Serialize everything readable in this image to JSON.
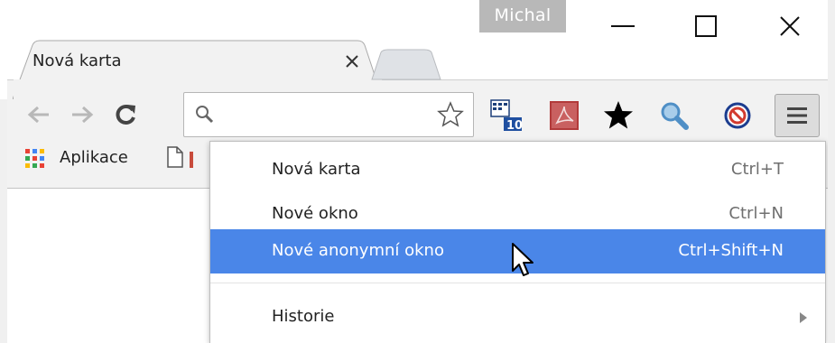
{
  "window": {
    "profile_name": "Michal",
    "controls": [
      "minimize",
      "maximize",
      "close"
    ]
  },
  "tabs": [
    {
      "title": "Nová karta",
      "active": true
    }
  ],
  "toolbar": {
    "omnibox_value": "",
    "extensions": [
      "calendar-10-icon",
      "acrobat-icon",
      "star-icon",
      "magnifier-icon",
      "block-icon"
    ],
    "menu_icon": "hamburger-icon"
  },
  "bookmarks_bar": {
    "apps_label": "Aplikace"
  },
  "menu": {
    "items": [
      {
        "label": "Nová karta",
        "shortcut": "Ctrl+T"
      },
      {
        "label": "Nové okno",
        "shortcut": "Ctrl+N"
      },
      {
        "label": "Nové anonymní okno",
        "shortcut": "Ctrl+Shift+N",
        "selected": true
      },
      {
        "label": "Historie",
        "has_submenu": true
      }
    ]
  },
  "colors": {
    "selected_item": "#4a86e8",
    "profile_badge": "#b8b8b8"
  }
}
